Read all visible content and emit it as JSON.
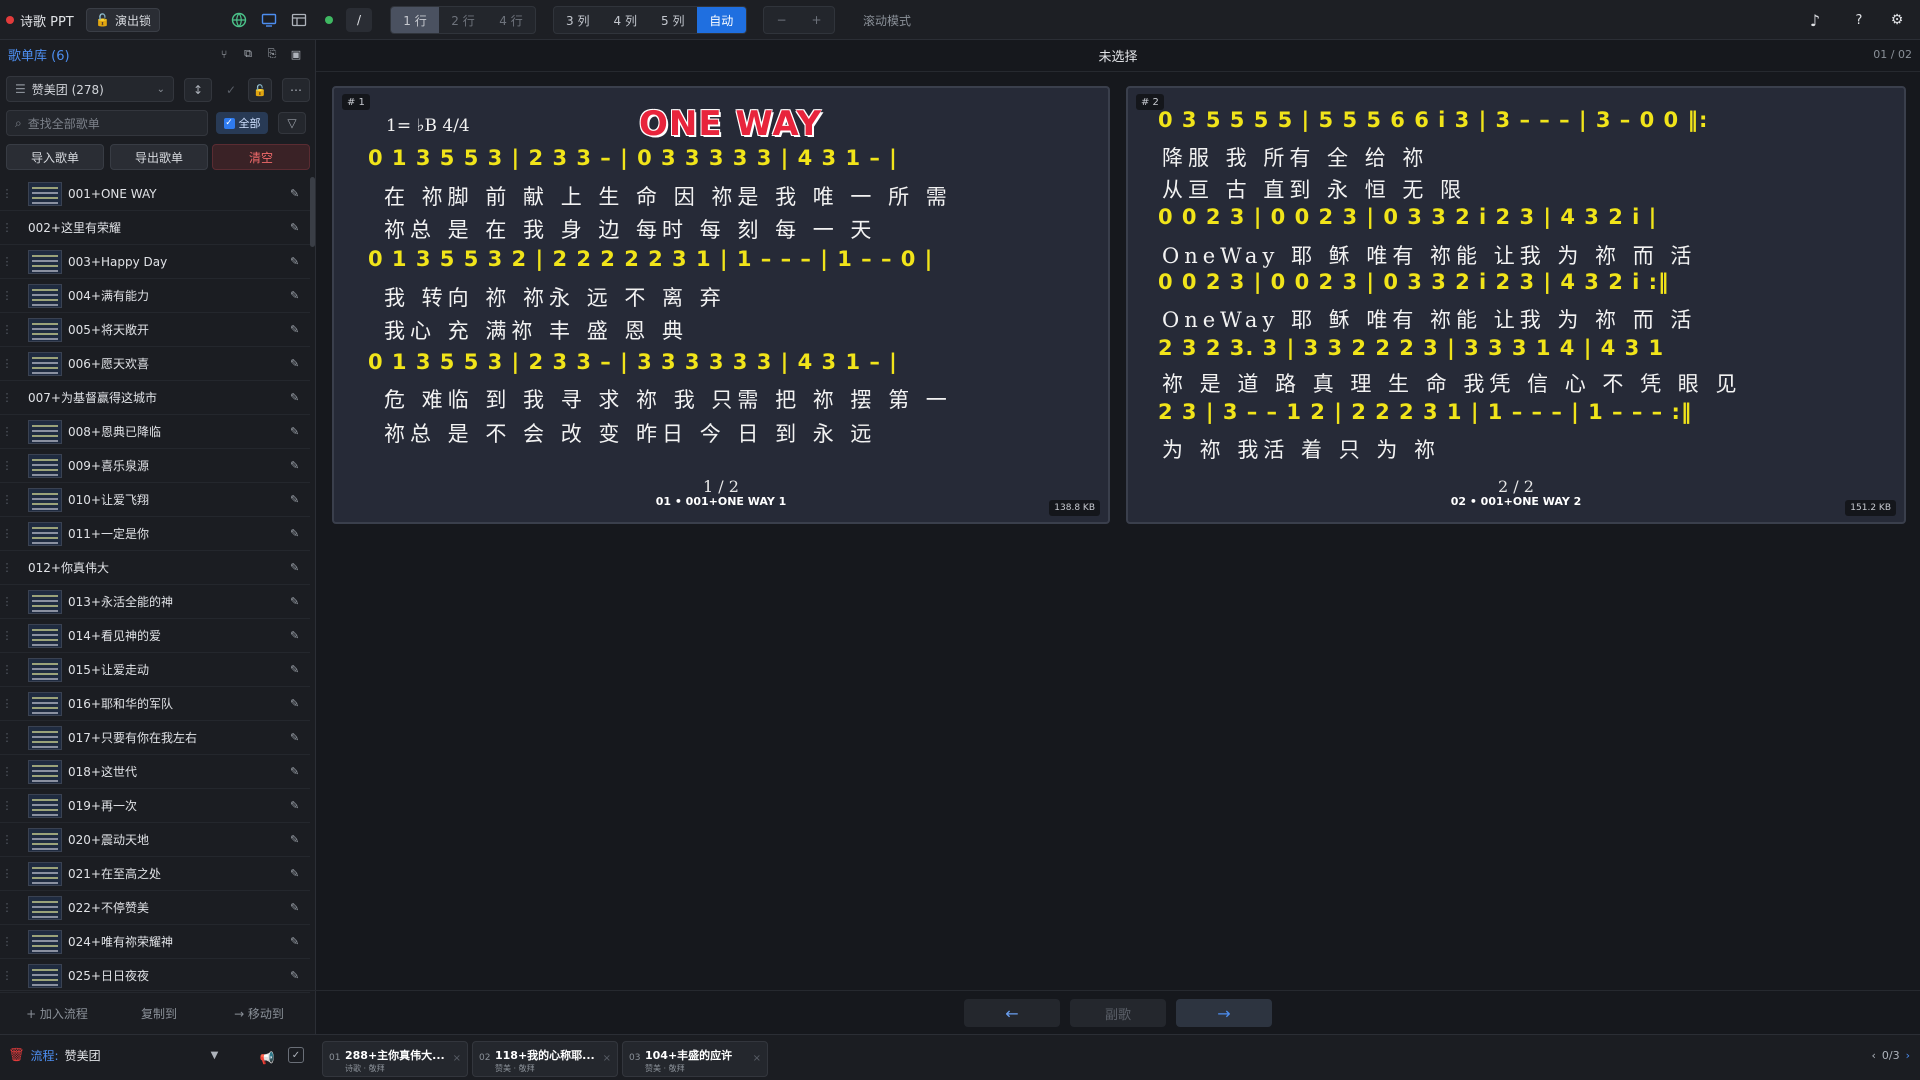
{
  "app": {
    "name": "诗歌 PPT",
    "show_lock": "演出锁"
  },
  "toolbar": {
    "rows": [
      "1 行",
      "2 行",
      "4 行"
    ],
    "cols": [
      "3 列",
      "4 列",
      "5 列",
      "自动"
    ],
    "zoom": [
      "−",
      "+"
    ],
    "scroll_mode": "滚动模式",
    "slash": "/",
    "music_icon": "♪",
    "help": "?",
    "settings_icon": "⚙"
  },
  "sidebar": {
    "title": "歌单库 (6)",
    "library": "赞美团 (278)",
    "search_placeholder": "查找全部歌单",
    "check_all": "全部",
    "import": "导入歌单",
    "export": "导出歌单",
    "clear": "清空",
    "items": [
      {
        "label": "001+ONE WAY",
        "thumb": true
      },
      {
        "label": "002+这里有荣耀",
        "thumb": false
      },
      {
        "label": "003+Happy Day",
        "thumb": true
      },
      {
        "label": "004+满有能力",
        "thumb": true
      },
      {
        "label": "005+将天敞开",
        "thumb": true
      },
      {
        "label": "006+愿天欢喜",
        "thumb": true
      },
      {
        "label": "007+为基督赢得这城市",
        "thumb": false
      },
      {
        "label": "008+恩典已降临",
        "thumb": true
      },
      {
        "label": "009+喜乐泉源",
        "thumb": true
      },
      {
        "label": "010+让爱飞翔",
        "thumb": true
      },
      {
        "label": "011+一定是你",
        "thumb": true
      },
      {
        "label": "012+你真伟大",
        "thumb": false
      },
      {
        "label": "013+永活全能的神",
        "thumb": true
      },
      {
        "label": "014+看见神的爱",
        "thumb": true
      },
      {
        "label": "015+让爱走动",
        "thumb": true
      },
      {
        "label": "016+耶和华的军队",
        "thumb": true
      },
      {
        "label": "017+只要有你在我左右",
        "thumb": true
      },
      {
        "label": "018+这世代",
        "thumb": true
      },
      {
        "label": "019+再一次",
        "thumb": true
      },
      {
        "label": "020+震动天地",
        "thumb": true
      },
      {
        "label": "021+在至高之处",
        "thumb": true
      },
      {
        "label": "022+不停赞美",
        "thumb": true
      },
      {
        "label": "024+唯有祢荣耀神",
        "thumb": true
      },
      {
        "label": "025+日日夜夜",
        "thumb": true
      }
    ],
    "add_flow": "+ 加入流程",
    "copy_to": "复制到",
    "move_to": "→ 移动到"
  },
  "main": {
    "title": "未选择",
    "count": "01 / 02",
    "slides": [
      {
        "badge": "# 1",
        "size": "138.8 KB",
        "caption": "01 • 001+ONE WAY 1",
        "page": "1 / 2",
        "song_title": "ONE WAY",
        "key": "1= ♭B  4/4",
        "rows": [
          {
            "type": "n",
            "text": "0 1  3 5  5  3 | 2  3  3 – | 0 3  3 3  3  3 | 4  3  1 – |"
          },
          {
            "type": "l",
            "text": "在 祢脚 前 献 上 生 命   因 祢是 我 唯 一 所 需"
          },
          {
            "type": "l",
            "text": "  祢总 是 在 我 身 边     每时 每 刻 每 一 天"
          },
          {
            "type": "n",
            "text": "0 1  3 5  5  3 2 | 2 2  2 2  2  3  1 | 1 – – – | 1 – – 0 |"
          },
          {
            "type": "l",
            "text": "我 转向 祢 祢永  远  不   离 弃"
          },
          {
            "type": "l",
            "text": "  我心 充 满祢  丰  盛   恩 典"
          },
          {
            "type": "n",
            "text": "0 1  3 5  5  3 | 2  3  3 – | 3 3  3 3  3  3 | 4  3  1 – |"
          },
          {
            "type": "l",
            "text": "危 难临 到 我 寻 求 祢    我 只需 把 祢 摆 第 一"
          },
          {
            "type": "l",
            "text": "  祢总 是 不 会 改 变      昨日 今 日 到 永 远"
          }
        ]
      },
      {
        "badge": "# 2",
        "size": "151.2 KB",
        "caption": "02 • 001+ONE WAY 2",
        "page": "2 / 2",
        "rows": [
          {
            "type": "n",
            "text": "0  3 5  5  5 5 | 5 5  5 6  6  i  3 | 3 – – – | 3 –  0 0 ‖:"
          },
          {
            "type": "l",
            "text": " 降服 我 所有     全   给 祢"
          },
          {
            "type": "l",
            "text": " 从亘 古 直到   永   恒   无 限"
          },
          {
            "type": "n",
            "text": "0  0 2  3 | 0  0 2  3 | 0  3 3  2 i  2 3 | 4  3  2  i |"
          },
          {
            "type": "l",
            "text": "   OneWay  耶 稣   唯有 祢能 让我 为 祢 而 活"
          },
          {
            "type": "n",
            "text": "0  0 2  3 | 0  0 2  3 | 0  3 3  2 i  2 3 | 4  3  2  i :‖"
          },
          {
            "type": "l",
            "text": "   OneWay  耶 稣   唯有 祢能 让我 为 祢 而 活"
          },
          {
            "type": "n",
            "text": "2  3  2  3. 3 | 3  3  2  2  2 3 | 3  3  3  1  4 | 4  3  1"
          },
          {
            "type": "l",
            "text": "祢 是 道 路 真  理 生 命 我凭  信 心 不 凭   眼 见"
          },
          {
            "type": "n",
            "text": "2  3 | 3 – – 1 2 | 2  2  2  3  1 | 1 – – – | 1 – – – :‖"
          },
          {
            "type": "l",
            "text": "为 祢    我活   着 只 为 祢"
          }
        ]
      }
    ]
  },
  "nav": {
    "prev": "←",
    "mid": "副歌",
    "next": "→"
  },
  "flow": {
    "label": "流程:",
    "name": "赞美团",
    "items": [
      {
        "idx": "01",
        "title": "288+主你真伟大...",
        "sub": "诗歌 · 敬拜"
      },
      {
        "idx": "02",
        "title": "118+我的心称耶...",
        "sub": "赞美 · 敬拜"
      },
      {
        "idx": "03",
        "title": "104+丰盛的应许",
        "sub": "赞美 · 敬拜"
      }
    ],
    "pager": "0/3"
  },
  "colors": {
    "accent": "#1f6fe0",
    "notation": "#f1e41a",
    "title_red": "#e8243c",
    "danger": "#f06a6a"
  }
}
